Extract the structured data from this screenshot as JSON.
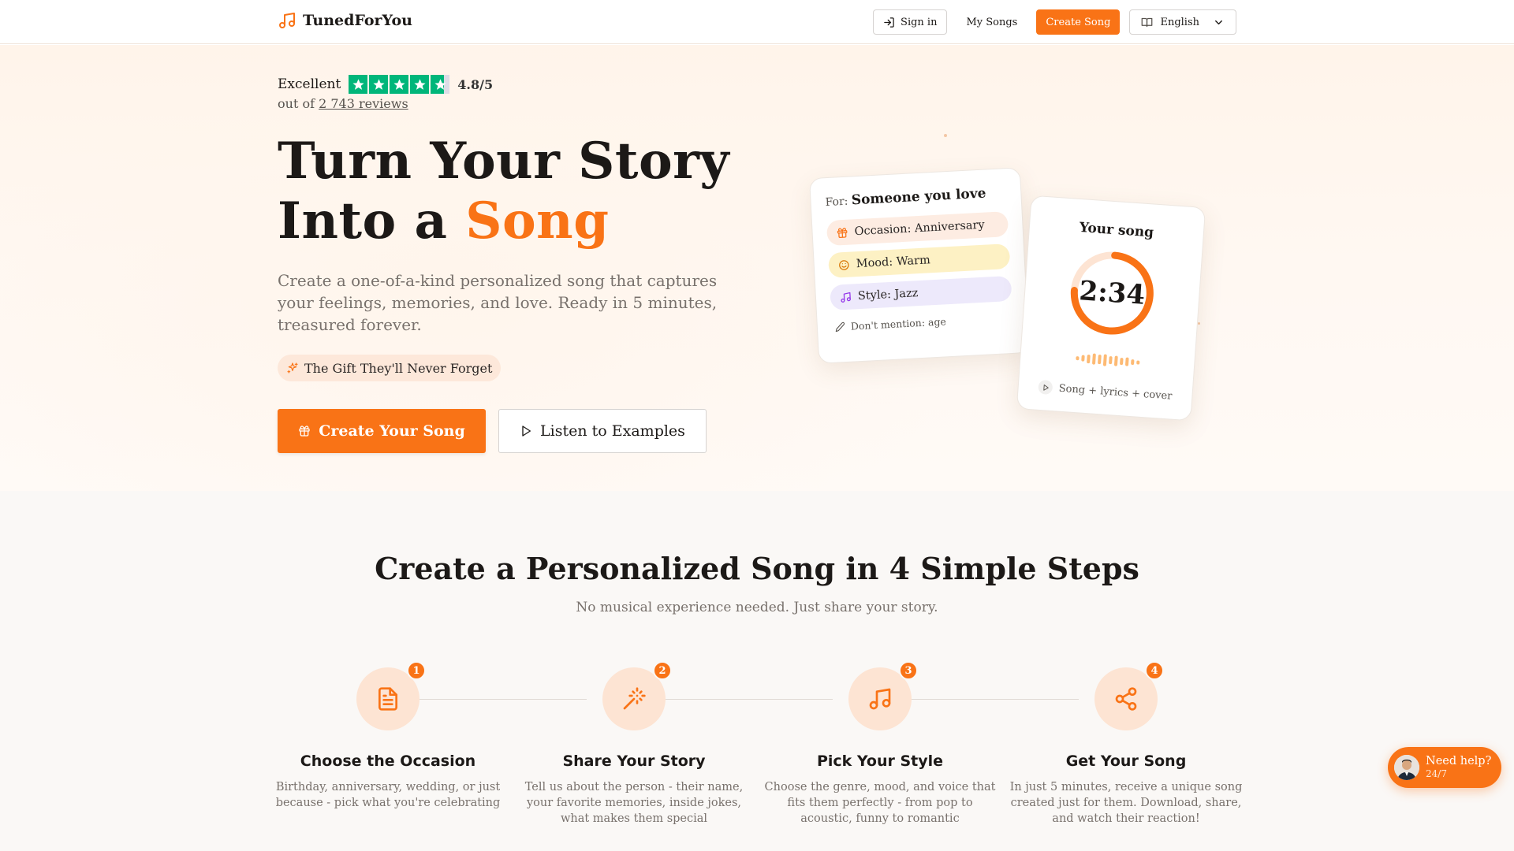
{
  "header": {
    "brand": "TunedForYou",
    "sign_in": "Sign in",
    "my_songs": "My Songs",
    "create_song": "Create Song",
    "language": "English"
  },
  "hero": {
    "rating_label": "Excellent",
    "rating_score": "4.8/5",
    "reviews_prefix": "out of",
    "reviews_link": "2 743 reviews",
    "title_line1": "Turn Your Story",
    "title_line2_prefix": "Into a",
    "title_line2_accent": "Song",
    "subtitle": "Create a one-of-a-kind personalized song that captures your feelings, memories, and love. Ready in 5 minutes, treasured forever.",
    "pill": "The Gift They'll Never Forget",
    "cta_primary": "Create Your Song",
    "cta_secondary": "Listen to Examples"
  },
  "preview_card": {
    "for_label": "For:",
    "for_value": "Someone you love",
    "tags": [
      {
        "label": "Occasion: Anniversary",
        "icon": "gift-icon"
      },
      {
        "label": "Mood: Warm",
        "icon": "smile-icon"
      },
      {
        "label": "Style: Jazz",
        "icon": "music-note-icon"
      }
    ],
    "note": "Don't mention: age"
  },
  "song_card": {
    "title": "Your song",
    "duration": "2:34",
    "includes": "Song + lyrics + cover"
  },
  "steps": {
    "title": "Create a Personalized Song in 4 Simple Steps",
    "subtitle": "No musical experience needed. Just share your story.",
    "items": [
      {
        "number": "1",
        "title": "Choose the Occasion",
        "desc": "Birthday, anniversary, wedding, or just because - pick what you're celebrating",
        "icon": "document-icon"
      },
      {
        "number": "2",
        "title": "Share Your Story",
        "desc": "Tell us about the person - their name, your favorite memories, inside jokes, what makes them special",
        "icon": "magic-wand-icon"
      },
      {
        "number": "3",
        "title": "Pick Your Style",
        "desc": "Choose the genre, mood, and voice that fits them perfectly - from pop to acoustic, funny to romantic",
        "icon": "music-note-icon"
      },
      {
        "number": "4",
        "title": "Get Your Song",
        "desc": "In just 5 minutes, receive a unique song created just for them. Download, share, and watch their reaction!",
        "icon": "share-icon"
      }
    ]
  },
  "help_widget": {
    "title": "Need help?",
    "subtitle": "24/7"
  },
  "colors": {
    "accent": "#f97316",
    "trustpilot_green": "#00b67a"
  }
}
